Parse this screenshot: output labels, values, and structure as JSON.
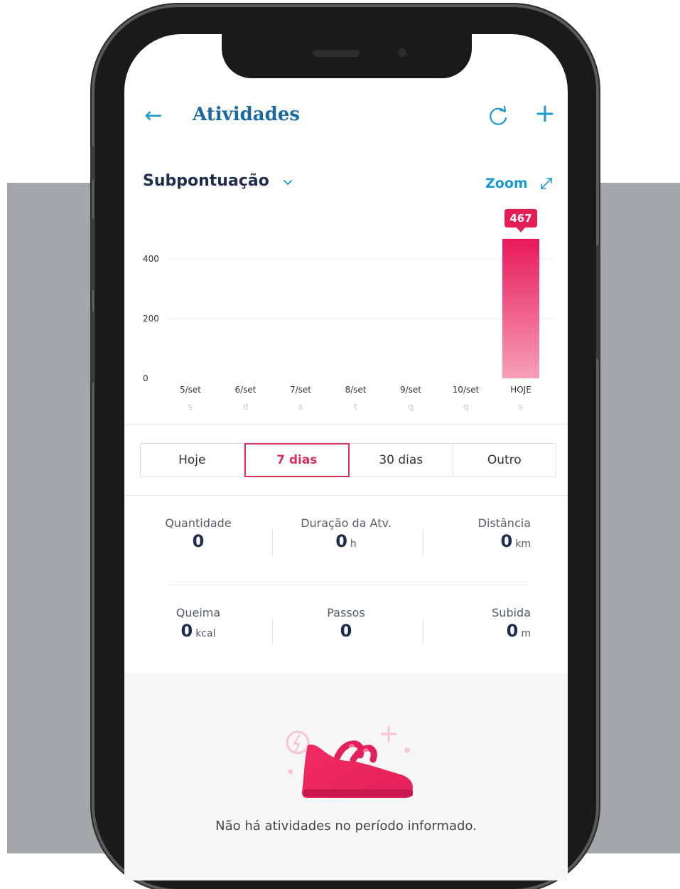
{
  "header": {
    "title": "Atividades"
  },
  "metric": {
    "title": "Subpontuação",
    "zoom_label": "Zoom"
  },
  "chart_data": {
    "type": "bar",
    "categories": [
      "5/set",
      "6/set",
      "7/set",
      "8/set",
      "9/set",
      "10/set",
      "HOJE"
    ],
    "day_initials": [
      "s",
      "d",
      "s",
      "t",
      "q",
      "q",
      "s"
    ],
    "values": [
      0,
      0,
      0,
      0,
      0,
      0,
      467
    ],
    "highlight_label": "467",
    "y_ticks": [
      0,
      200,
      400
    ],
    "ylim": [
      0,
      520
    ],
    "bar_color_top": "#e8195a",
    "bar_color_bottom": "#f6a0b7"
  },
  "period": {
    "options": [
      "Hoje",
      "7 dias",
      "30 dias",
      "Outro"
    ],
    "selected_index": 1
  },
  "stats": [
    {
      "label": "Quantidade",
      "value": "0",
      "unit": ""
    },
    {
      "label": "Duração da Atv.",
      "value": "0",
      "unit": "h"
    },
    {
      "label": "Distância",
      "value": "0",
      "unit": "km"
    },
    {
      "label": "Queima",
      "value": "0",
      "unit": "kcal"
    },
    {
      "label": "Passos",
      "value": "0",
      "unit": ""
    },
    {
      "label": "Subida",
      "value": "0",
      "unit": "m"
    }
  ],
  "empty_state": {
    "icon": "sneaker-icon",
    "message": "Não há atividades no período informado."
  },
  "colors": {
    "accent_blue": "#1a9ac8",
    "accent_pink": "#d8325d",
    "navy_text": "#1f2d4d"
  }
}
